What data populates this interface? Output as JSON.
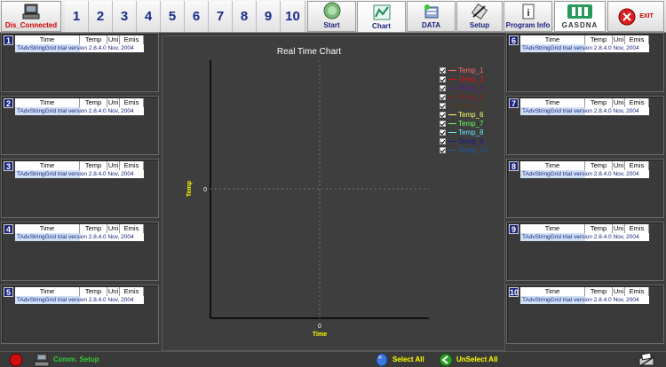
{
  "toolbar": {
    "connection_label": "Dis_Connected",
    "numbers": [
      "1",
      "2",
      "3",
      "4",
      "5",
      "6",
      "7",
      "8",
      "9",
      "10"
    ],
    "start_label": "Start",
    "chart_label": "Chart",
    "data_label": "DATA",
    "setup_label": "Setup",
    "program_info_label": "Program Info",
    "logo_text": "GASDNA",
    "exit_label": "EXIT"
  },
  "grid": {
    "headers": [
      "Time",
      "Temp",
      "Uni",
      "Emis"
    ],
    "trial_text": "TAdvStringGrid trial version 2.8.4.0 Nov, 2004"
  },
  "panels_left": [
    "1",
    "2",
    "3",
    "4",
    "5"
  ],
  "panels_right": [
    "6",
    "7",
    "8",
    "9",
    "10"
  ],
  "chart_data": {
    "type": "line",
    "title": "Real Time Chart",
    "xlabel": "Time",
    "ylabel": "Temp",
    "x_tick": "0",
    "y_tick": "0",
    "grid": true,
    "legend_position": "top-right",
    "series": [
      {
        "name": "Temp_1",
        "color": "#ff6b6b",
        "checked": true
      },
      {
        "name": "Temp_2",
        "color": "#e01010",
        "checked": true
      },
      {
        "name": "Temp_3",
        "color": "#5a1a8c",
        "checked": true
      },
      {
        "name": "Temp_4",
        "color": "#8b1a1a",
        "checked": true
      },
      {
        "name": "Temp_5",
        "color": "#5a3a0a",
        "checked": true
      },
      {
        "name": "Temp_6",
        "color": "#ffff66",
        "checked": true
      },
      {
        "name": "Temp_7",
        "color": "#66ff66",
        "checked": true
      },
      {
        "name": "Temp_8",
        "color": "#66e6ff",
        "checked": true
      },
      {
        "name": "Temp_9",
        "color": "#1a1a8c",
        "checked": true
      },
      {
        "name": "Temp_10",
        "color": "#1e5aa8",
        "checked": true
      }
    ]
  },
  "status": {
    "comm_setup": "Comm. Setup",
    "select_all": "Select All",
    "unselect_all": "UnSelect All"
  }
}
